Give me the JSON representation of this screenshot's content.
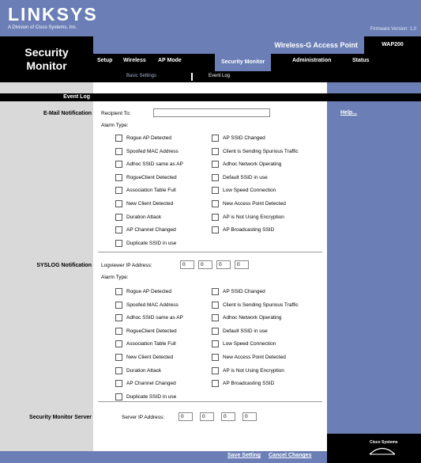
{
  "brand": {
    "logo": "LINKSYS",
    "logo_sub": "A Division of Cisco Systems, Inc.",
    "firmware": "Firmware Version: 1.0"
  },
  "page_title_line1": "Security",
  "page_title_line2": "Monitor",
  "product": {
    "name": "Wireless-G Access Point",
    "model": "WAP200"
  },
  "tabs": [
    "Setup",
    "Wireless",
    "AP Mode",
    "Security Monitor",
    "Administration",
    "Status"
  ],
  "active_tab": "Security Monitor",
  "subtabs": [
    "Basic Settings",
    "Event Log"
  ],
  "active_subtab": "Event Log",
  "section_header": "Event Log",
  "help_link": "Help...",
  "email": {
    "label": "E-Mail Notification",
    "recipient_label": "Recipient To:",
    "recipient_value": "",
    "alarm_type_label": "Alarm Type:"
  },
  "syslog": {
    "label": "SYSLOG Notification",
    "ip_label": "Logviewer IP Address:",
    "ip": [
      "0",
      "0",
      "0",
      "0"
    ],
    "alarm_type_label": "Alarm Type:"
  },
  "server": {
    "label": "Security Monitor Server",
    "ip_label": "Server IP Address:",
    "ip": [
      "0",
      "0",
      "0",
      "0"
    ]
  },
  "alarms_left": [
    "Rogue AP Detected",
    "Spoofed MAC Address",
    "Adhoc SSID same as AP",
    "RogueClient Detected",
    "Association Table Full",
    "New Client Detected",
    "Duration Attack",
    "AP Channel Changed",
    "Duplicate SSID in use"
  ],
  "alarms_right": [
    "AP SSID Changed",
    "Client is Sending Spurious Traffic",
    "Adhoc Network Operating",
    "Default SSID in use",
    "Low Speed Connection",
    "New Access Point Detected",
    "AP is Not Using Encryption",
    "AP Broadcasting SSID"
  ],
  "footer": {
    "save": "Save Setting",
    "cancel": "Cancel Changes",
    "cisco": "Cisco Systems"
  },
  "colors": {
    "brand_blue": "#6b7fb6",
    "header_black": "#000000",
    "panel_gray": "#d9d9d9"
  }
}
